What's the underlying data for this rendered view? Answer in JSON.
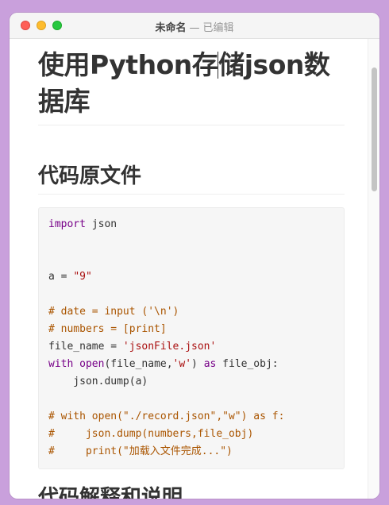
{
  "window": {
    "title": "未命名",
    "separator": "—",
    "status": "已编辑"
  },
  "document": {
    "heading1_before_caret": "使用Python存",
    "heading1_after_caret": "储json数据库",
    "heading2": "代码原文件",
    "heading3": "代码解释和说明"
  },
  "code": {
    "lines": [
      [
        {
          "t": "import",
          "c": "kw"
        },
        {
          "t": " json",
          "c": ""
        }
      ],
      [],
      [],
      [
        {
          "t": "a = ",
          "c": ""
        },
        {
          "t": "\"9\"",
          "c": "str"
        }
      ],
      [],
      [
        {
          "t": "# date = input ('\\n')",
          "c": "cm"
        }
      ],
      [
        {
          "t": "# numbers = [print]",
          "c": "cm"
        }
      ],
      [
        {
          "t": "file_name = ",
          "c": ""
        },
        {
          "t": "'jsonFile.json'",
          "c": "str"
        }
      ],
      [
        {
          "t": "with",
          "c": "kw"
        },
        {
          "t": " ",
          "c": ""
        },
        {
          "t": "open",
          "c": "kw"
        },
        {
          "t": "(file_name,",
          "c": ""
        },
        {
          "t": "'w'",
          "c": "str"
        },
        {
          "t": ") ",
          "c": ""
        },
        {
          "t": "as",
          "c": "kw"
        },
        {
          "t": " file_obj:",
          "c": ""
        }
      ],
      [
        {
          "t": "    json.dump(a)",
          "c": ""
        }
      ],
      [],
      [
        {
          "t": "# with open(\"./record.json\",\"w\") as f:",
          "c": "cm"
        }
      ],
      [
        {
          "t": "#     json.dump(numbers,file_obj)",
          "c": "cm"
        }
      ],
      [
        {
          "t": "#     print(\"加载入文件完成...\")",
          "c": "cm"
        }
      ]
    ]
  },
  "colors": {
    "keyword": "#770088",
    "string": "#aa1111",
    "comment": "#aa5500",
    "close_button": "#fe5f57",
    "minimize_button": "#febc2e",
    "zoom_button": "#28c840"
  }
}
